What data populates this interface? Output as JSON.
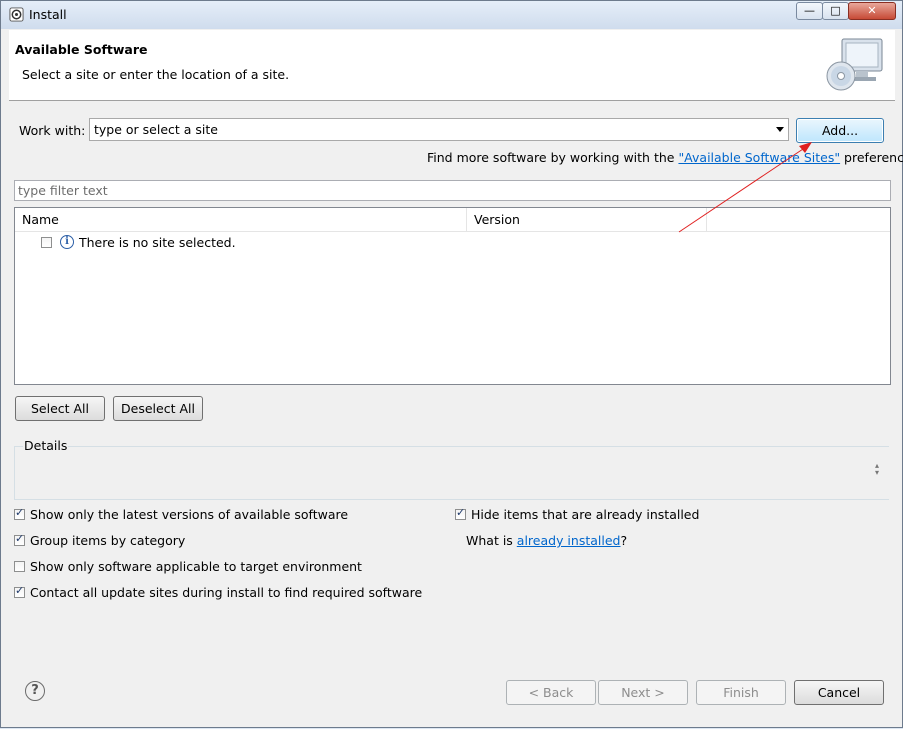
{
  "window": {
    "title": "Install",
    "minimize_glyph": "—",
    "maximize_glyph": "□",
    "close_glyph": "✕"
  },
  "banner": {
    "title": "Available Software",
    "subtitle": "Select a site or enter the location of a site.",
    "icon": "monitor-cd-icon"
  },
  "work_with": {
    "label": "Work with:",
    "value": "type or select a site",
    "add_button": "Add..."
  },
  "find_more": {
    "prefix": "Find more software by working with the ",
    "link": "\"Available Software Sites\"",
    "suffix": " preferences."
  },
  "filter": {
    "placeholder": "type filter text"
  },
  "table": {
    "columns": [
      "Name",
      "Version"
    ],
    "empty_message": "There is no site selected."
  },
  "selection_buttons": {
    "select_all": "Select All",
    "deselect_all": "Deselect All"
  },
  "details": {
    "title": "Details",
    "spinner_up": "▴",
    "spinner_down": "▾"
  },
  "options": {
    "latest_versions": {
      "label": "Show only the latest versions of available software",
      "checked": true
    },
    "group_by_category": {
      "label": "Group items by category",
      "checked": true
    },
    "target_environment": {
      "label": "Show only software applicable to target environment",
      "checked": false
    },
    "contact_update_sites": {
      "label": "Contact all update sites during install to find required software",
      "checked": true
    },
    "hide_installed": {
      "label": "Hide items that are already installed",
      "checked": true
    },
    "what_is_prefix": "What is ",
    "what_is_link": "already installed",
    "what_is_suffix": "?"
  },
  "footer": {
    "help_glyph": "?",
    "back": "< Back",
    "next": "Next >",
    "finish": "Finish",
    "cancel": "Cancel"
  },
  "colors": {
    "link": "#0066cc",
    "annotation_arrow": "#e02020"
  }
}
